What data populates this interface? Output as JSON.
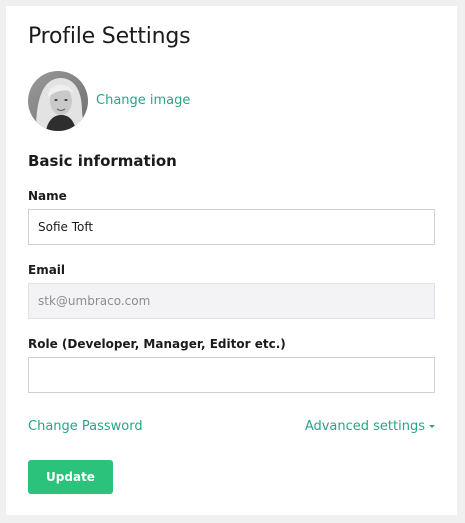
{
  "page": {
    "title": "Profile Settings"
  },
  "avatar": {
    "change_label": "Change image"
  },
  "basic": {
    "section_title": "Basic information",
    "name_label": "Name",
    "name_value": "Sofie Toft",
    "email_label": "Email",
    "email_value": "stk@umbraco.com",
    "role_label": "Role (Developer, Manager, Editor etc.)",
    "role_value": ""
  },
  "links": {
    "change_password": "Change Password",
    "advanced_settings": "Advanced settings"
  },
  "actions": {
    "update_label": "Update"
  },
  "colors": {
    "accent": "#2aa388",
    "button": "#2bc37c"
  }
}
